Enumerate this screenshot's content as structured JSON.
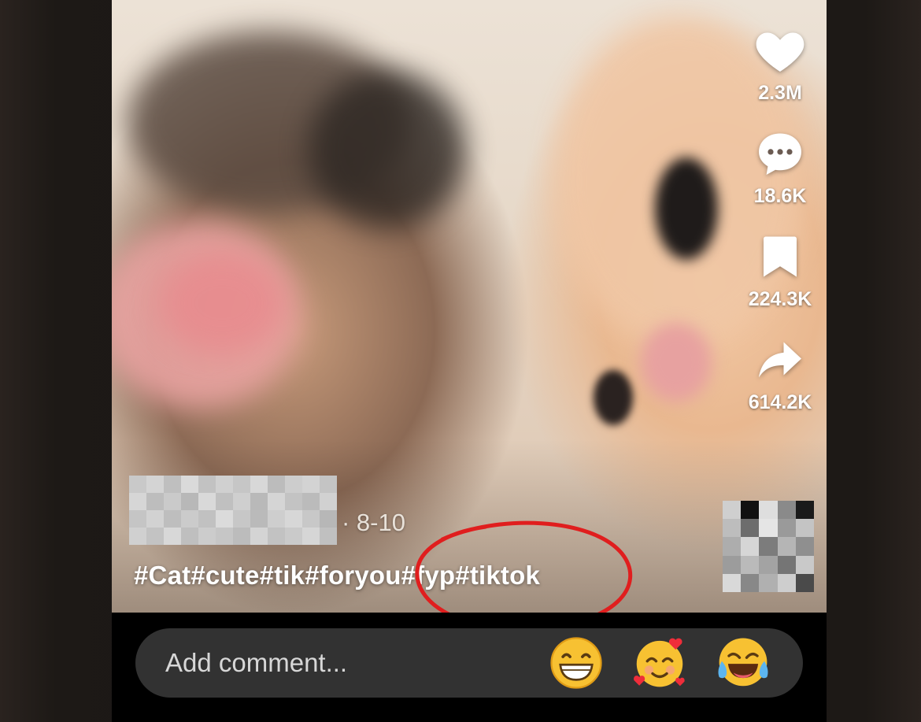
{
  "video": {
    "actions": [
      {
        "name": "like",
        "icon": "heart-icon",
        "count": "2.3M"
      },
      {
        "name": "comment",
        "icon": "comment-bubble-icon",
        "count": "18.6K"
      },
      {
        "name": "favorite",
        "icon": "bookmark-icon",
        "count": "224.3K"
      },
      {
        "name": "share",
        "icon": "share-arrow-icon",
        "count": "614.2K"
      }
    ],
    "post_date": "· 8-10",
    "caption": "#Cat#cute#tik#foryou#fyp#tiktok",
    "annotation_color": "#e01e1e"
  },
  "comment_bar": {
    "placeholder": "Add comment...",
    "emojis": [
      "😁",
      "🥰",
      "😂"
    ]
  }
}
